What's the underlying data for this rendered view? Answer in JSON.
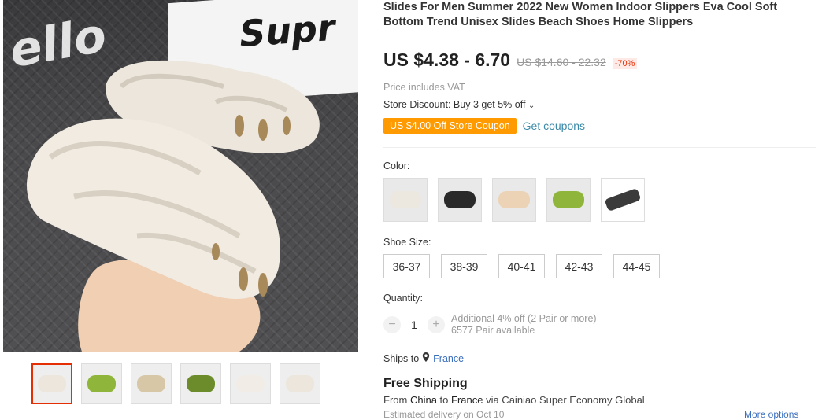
{
  "product": {
    "title": "Slides For Men Summer 2022 New Women Indoor Slippers Eva Cool Soft Bottom Trend Unisex Slides Beach Shoes Home Slippers",
    "price": "US $4.38 - 6.70",
    "original_price": "US $14.60 - 22.32",
    "discount": "-70%",
    "vat_note": "Price includes VAT",
    "store_discount": "Store Discount: Buy 3 get 5% off",
    "coupon_label": "US $4.00 Off Store Coupon",
    "get_coupons": "Get coupons"
  },
  "color": {
    "label": "Color:",
    "options": [
      {
        "name": "white",
        "swatch": "#ece7df"
      },
      {
        "name": "black",
        "swatch": "#2a2a2a"
      },
      {
        "name": "apricot",
        "swatch": "#ecd3b5"
      },
      {
        "name": "green",
        "swatch": "#8fb63b"
      },
      {
        "name": "black-slide",
        "swatch": "#3b3b3b"
      }
    ]
  },
  "size": {
    "label": "Shoe Size:",
    "options": [
      "36-37",
      "38-39",
      "40-41",
      "42-43",
      "44-45"
    ]
  },
  "quantity": {
    "label": "Quantity:",
    "value": "1",
    "minus": "−",
    "plus": "+",
    "offer": "Additional 4% off (2 Pair or more)",
    "available": "6577 Pair available"
  },
  "shipping": {
    "ships_to_label": "Ships to",
    "location": "France",
    "free_shipping": "Free Shipping",
    "route_from": "From ",
    "origin": "China",
    "route_to": " to ",
    "destination": "France",
    "route_via": " via Cainiao Super Economy Global",
    "estimated": "Estimated delivery on Oct 10",
    "more_options": "More options"
  },
  "gallery": {
    "main_texts": {
      "box": "Supr",
      "wall": "ello"
    },
    "thumbnails": [
      "white",
      "green",
      "beige",
      "green-dark",
      "white-2",
      "white-3"
    ],
    "selected_index": 0
  }
}
